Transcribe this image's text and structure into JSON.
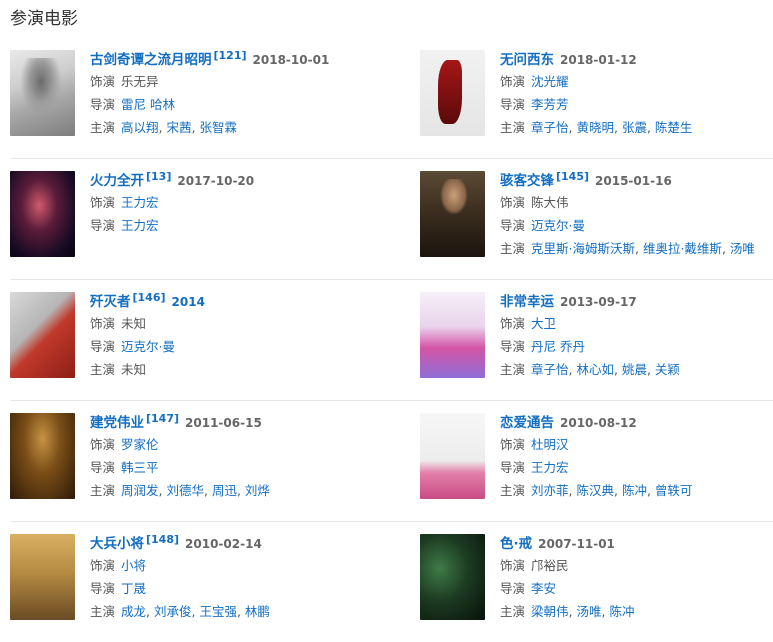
{
  "section": {
    "title": "参演电影"
  },
  "labels": {
    "role": "饰演",
    "director": "导演",
    "cast": "主演"
  },
  "movies": [
    {
      "title": "古剑奇谭之流月昭明",
      "count": "[121]",
      "date": "2018-10-01",
      "role": "乐无异",
      "directors": [
        "雷尼",
        "哈林"
      ],
      "cast": [
        "高以翔",
        "宋茜",
        "张智霖"
      ],
      "poster_icon": "movie-poster"
    },
    {
      "title": "无问西东",
      "count": "",
      "date": "2018-01-12",
      "role": "沈光耀",
      "directors": [
        "李芳芳"
      ],
      "cast": [
        "章子怡",
        "黄晓明",
        "张震",
        "陈楚生"
      ],
      "poster_icon": "movie-poster"
    },
    {
      "title": "火力全开",
      "count": "[13]",
      "date": "2017-10-20",
      "role": "王力宏",
      "directors": [
        "王力宏"
      ],
      "cast": [],
      "poster_icon": "movie-poster"
    },
    {
      "title": "骇客交锋",
      "count": "[145]",
      "date": "2015-01-16",
      "role": "陈大伟",
      "directors": [
        "迈克尔·曼"
      ],
      "cast": [
        "克里斯·海姆斯沃斯",
        "维奥拉·戴维斯",
        "汤唯"
      ],
      "poster_icon": "movie-poster"
    },
    {
      "title": "歼灭者",
      "count": "[146]",
      "date": "2014",
      "role": "未知",
      "directors": [
        "迈克尔·曼"
      ],
      "cast": [
        "未知"
      ],
      "poster_icon": "movie-poster"
    },
    {
      "title": "非常幸运",
      "count": "",
      "date": "2013-09-17",
      "role": "大卫",
      "directors": [
        "丹尼",
        "乔丹"
      ],
      "cast": [
        "章子怡",
        "林心如",
        "姚晨",
        "关颖"
      ],
      "poster_icon": "movie-poster"
    },
    {
      "title": "建党伟业",
      "count": "[147]",
      "date": "2011-06-15",
      "role": "罗家伦",
      "directors": [
        "韩三平"
      ],
      "cast": [
        "周润发",
        "刘德华",
        "周迅",
        "刘烨"
      ],
      "poster_icon": "movie-poster"
    },
    {
      "title": "恋爱通告",
      "count": "",
      "date": "2010-08-12",
      "role": "杜明汉",
      "directors": [
        "王力宏"
      ],
      "cast": [
        "刘亦菲",
        "陈汉典",
        "陈冲",
        "曾轶可"
      ],
      "poster_icon": "movie-poster"
    },
    {
      "title": "大兵小将",
      "count": "[148]",
      "date": "2010-02-14",
      "role": "小将",
      "directors": [
        "丁晟"
      ],
      "cast": [
        "成龙",
        "刘承俊",
        "王宝强",
        "林鹏"
      ],
      "poster_icon": "movie-poster"
    },
    {
      "title": "色·戒",
      "count": "",
      "date": "2007-11-01",
      "role": "邝裕民",
      "directors": [
        "李安"
      ],
      "cast": [
        "梁朝伟",
        "汤唯",
        "陈冲"
      ],
      "poster_icon": "movie-poster"
    }
  ]
}
